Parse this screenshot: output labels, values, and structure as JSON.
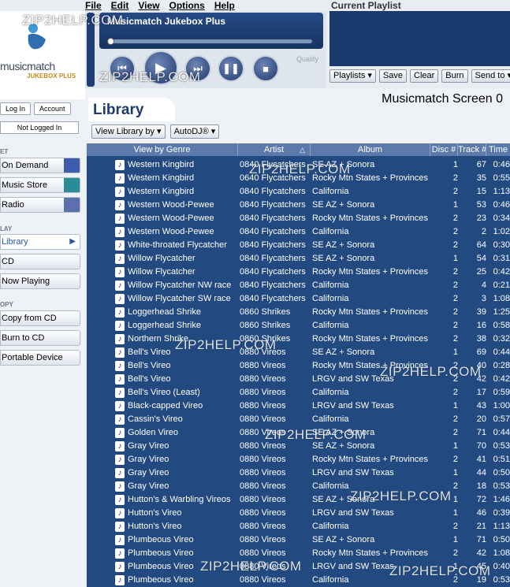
{
  "menu": [
    "File",
    "Edit",
    "View",
    "Options",
    "Help"
  ],
  "logo": {
    "text": "musicmatch",
    "sub": "JUKEBOX PLUS"
  },
  "player": {
    "title": "Musicmatch Jukebox Plus",
    "quality_label": "Quality",
    "buttons": [
      "previous-icon",
      "play-icon",
      "next-icon",
      "pause-icon",
      "stop-icon"
    ]
  },
  "playlist": {
    "title": "Current Playlist",
    "buttons": [
      "Playlists ▾",
      "Save",
      "Clear",
      "Burn",
      "Send to ▾"
    ]
  },
  "account": {
    "login": "Log In",
    "account": "Account",
    "status": "Not Logged In"
  },
  "sidebar": {
    "sections": [
      {
        "head": "ET",
        "items": [
          "On Demand",
          "Music Store",
          "Radio"
        ]
      },
      {
        "head": "LAY",
        "items": [
          "Library",
          "CD",
          "Now Playing"
        ]
      },
      {
        "head": "OPY",
        "items": [
          "Copy from CD",
          "Burn to CD",
          "Portable Device"
        ]
      }
    ],
    "active": "Library",
    "tag_colors": {
      "On Demand": "#3f5db0",
      "Music Store": "#2a8c96",
      "Radio": "#5d6fae"
    }
  },
  "library": {
    "title": "Library",
    "screen_title": "Musicmatch Screen 0",
    "view_by": "View Library by ▾",
    "autodj": "AutoDJ® ▾"
  },
  "table": {
    "columns": [
      "View by Genre",
      "Artist",
      "Album",
      "Disc #",
      "Track #",
      "Time"
    ],
    "rows": [
      [
        "Western Kingbird",
        "0840 Flycatchers",
        "SE AZ + Sonora",
        "1",
        "67",
        "0:46"
      ],
      [
        "Western Kingbird",
        "0640 Flycatchers",
        "Rocky Mtn States + Provinces",
        "2",
        "35",
        "0:55"
      ],
      [
        "Western Kingbird",
        "0840 Flycatchers",
        "California",
        "2",
        "15",
        "1:13"
      ],
      [
        "Western Wood-Pewee",
        "0840 Flycatchers",
        "SE AZ + Sonora",
        "1",
        "53",
        "0:46"
      ],
      [
        "Western Wood-Pewee",
        "0840 Flycatchers",
        "Rocky Mtn States + Provinces",
        "2",
        "23",
        "0:34"
      ],
      [
        "Western Wood-Pewee",
        "0840 Flycatchers",
        "California",
        "2",
        "2",
        "1:02"
      ],
      [
        "White-throated Flycatcher",
        "0840 Flycatchers",
        "SE AZ + Sonora",
        "2",
        "64",
        "0:30"
      ],
      [
        "Willow Flycatcher",
        "0840 Flycatchers",
        "SE AZ + Sonora",
        "1",
        "54",
        "0:31"
      ],
      [
        "Willow Flycatcher",
        "0840 Flycatchers",
        "Rocky Mtn States + Provinces",
        "2",
        "25",
        "0:42"
      ],
      [
        "Willow Flycatcher NW race",
        "0840 Flycatchers",
        "California",
        "2",
        "4",
        "0:21"
      ],
      [
        "Willow Flycatcher SW race",
        "0840 Flycatchers",
        "California",
        "2",
        "3",
        "1:08"
      ],
      [
        "Loggerhead Shrike",
        "0860 Shrikes",
        "Rocky Mtn States + Provinces",
        "2",
        "39",
        "1:25"
      ],
      [
        "Loggerhead Shrike",
        "0860 Shrikes",
        "California",
        "2",
        "16",
        "0:58"
      ],
      [
        "Northern Shrike",
        "0860 Shrikes",
        "Rocky Mtn States + Provinces",
        "2",
        "38",
        "0:32"
      ],
      [
        "Bell's Vireo",
        "0880 Vireos",
        "SE AZ + Sonora",
        "1",
        "69",
        "0:44"
      ],
      [
        "Bell's Vireo",
        "0880 Vireos",
        "Rocky Mtn States + Provinces",
        "2",
        "40",
        "0:28"
      ],
      [
        "Bell's Vireo",
        "0880 Vireos",
        "LRGV and SW Texas",
        "2",
        "42",
        "0:42"
      ],
      [
        "Bell's Vireo (Least)",
        "0880 Vireos",
        "California",
        "2",
        "17",
        "0:59"
      ],
      [
        "Black-capped Vireo",
        "0880 Vireos",
        "LRGV and SW Texas",
        "1",
        "43",
        "1:00"
      ],
      [
        "Cassin's Vireo",
        "0880 Vireos",
        "California",
        "2",
        "20",
        "0:57"
      ],
      [
        "Golden Vireo",
        "0880 Vireos",
        "SE AZ + Sonora",
        "2",
        "71",
        "0:44"
      ],
      [
        "Gray Vireo",
        "0880 Vireos",
        "SE AZ + Sonora",
        "1",
        "70",
        "0:53"
      ],
      [
        "Gray Vireo",
        "0880 Vireos",
        "Rocky Mtn States + Provinces",
        "2",
        "41",
        "0:51"
      ],
      [
        "Gray Vireo",
        "0880 Vireos",
        "LRGV and SW Texas",
        "1",
        "44",
        "0:50"
      ],
      [
        "Gray Vireo",
        "0880 Vireos",
        "California",
        "2",
        "18",
        "0:53"
      ],
      [
        "Hutton's & Warbling Vireos",
        "0880 Vireos",
        "SE AZ + Sonora",
        "1",
        "72",
        "1:46"
      ],
      [
        "Hutton's Vireo",
        "0880 Vireos",
        "LRGV and SW Texas",
        "1",
        "46",
        "0:39"
      ],
      [
        "Hutton's Vireo",
        "0880 Vireos",
        "California",
        "2",
        "21",
        "1:13"
      ],
      [
        "Plumbeous Vireo",
        "0880 Vireos",
        "SE AZ + Sonora",
        "1",
        "71",
        "0:50"
      ],
      [
        "Plumbeous Vireo",
        "0880 Vireos",
        "Rocky Mtn States + Provinces",
        "2",
        "42",
        "1:08"
      ],
      [
        "Plumbeous Vireo",
        "0880 Vireos",
        "LRGV and SW Texas",
        "1",
        "45",
        "0:40"
      ],
      [
        "Plumbeous Vireo",
        "0880 Vireos",
        "California",
        "2",
        "19",
        "0:53"
      ]
    ]
  },
  "watermark": "ZIP2HELP.COM"
}
